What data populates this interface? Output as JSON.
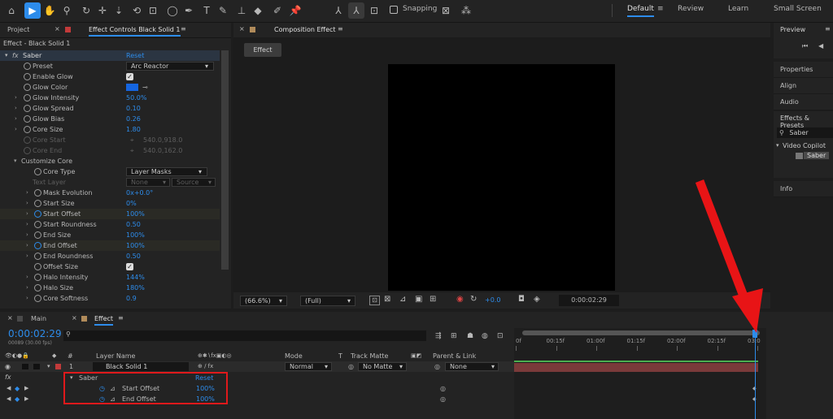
{
  "toolbar": {
    "snapping_label": "Snapping",
    "workspaces": [
      "Default",
      "Review",
      "Learn",
      "Small Screen"
    ]
  },
  "left_panel": {
    "tab_project": "Project",
    "tab_effect_controls": "Effect Controls Black Solid 1",
    "breadcrumb": "Effect - Black Solid 1",
    "effect_name": "Saber",
    "reset": "Reset",
    "props": {
      "preset": {
        "label": "Preset",
        "value": "Arc Reactor"
      },
      "enable_glow": {
        "label": "Enable Glow"
      },
      "glow_color": {
        "label": "Glow Color",
        "color": "#1565e0"
      },
      "glow_intensity": {
        "label": "Glow Intensity",
        "value": "50.0%"
      },
      "glow_spread": {
        "label": "Glow Spread",
        "value": "0.10"
      },
      "glow_bias": {
        "label": "Glow Bias",
        "value": "0.26"
      },
      "core_size": {
        "label": "Core Size",
        "value": "1.80"
      },
      "core_start": {
        "label": "Core Start",
        "value": "540.0,918.0"
      },
      "core_end": {
        "label": "Core End",
        "value": "540.0,162.0"
      },
      "customize_core": {
        "label": "Customize Core"
      },
      "core_type": {
        "label": "Core Type",
        "value": "Layer Masks"
      },
      "text_layer": {
        "label": "Text Layer",
        "value1": "None",
        "value2": "Source"
      },
      "mask_evolution": {
        "label": "Mask Evolution",
        "value": "0x+0.0°"
      },
      "start_size": {
        "label": "Start Size",
        "value": "0%"
      },
      "start_offset": {
        "label": "Start Offset",
        "value": "100%"
      },
      "start_roundness": {
        "label": "Start Roundness",
        "value": "0.50"
      },
      "end_size": {
        "label": "End Size",
        "value": "100%"
      },
      "end_offset": {
        "label": "End Offset",
        "value": "100%"
      },
      "end_roundness": {
        "label": "End Roundness",
        "value": "0.50"
      },
      "offset_size": {
        "label": "Offset Size"
      },
      "halo_intensity": {
        "label": "Halo Intensity",
        "value": "144%"
      },
      "halo_size": {
        "label": "Halo Size",
        "value": "180%"
      },
      "core_softness": {
        "label": "Core Softness",
        "value": "0.9"
      }
    }
  },
  "composition": {
    "tab": "Composition Effect",
    "sub_tab": "Effect",
    "zoom": "(66.6%)",
    "resolution": "(Full)",
    "exposure": "+0.0",
    "timecode": "0:00:02:29"
  },
  "right_panel": {
    "preview": "Preview",
    "properties": "Properties",
    "align": "Align",
    "audio": "Audio",
    "effects_presets": "Effects & Presets",
    "search_value": "Saber",
    "folder": "Video Copilot",
    "effect_item": "Saber",
    "info": "Info"
  },
  "timeline": {
    "tab_main": "Main",
    "tab_effect": "Effect",
    "current_time": "0:00:02:29",
    "frames": "00089 (30.00 fps)",
    "col_num": "#",
    "col_layer_name": "Layer Name",
    "col_mode": "Mode",
    "col_t": "T",
    "col_track_matte": "Track Matte",
    "col_parent": "Parent & Link",
    "layer": {
      "num": "1",
      "name": "Black Solid 1",
      "mode": "Normal",
      "matte": "No Matte",
      "parent": "None"
    },
    "fx_label": "fx",
    "effect_row": {
      "name": "Saber",
      "reset": "Reset"
    },
    "prop_rows": [
      {
        "name": "Start Offset",
        "value": "100%"
      },
      {
        "name": "End Offset",
        "value": "100%"
      }
    ],
    "ruler_labels": [
      "0f",
      "00:15f",
      "01:00f",
      "01:15f",
      "02:00f",
      "02:15f",
      "03:0"
    ],
    "playhead_position_seconds": 2.97
  },
  "colors": {
    "accent": "#2d8ceb",
    "highlight_box": "#e0191b",
    "arrow": "#e81416",
    "layer_bar": "#7a3a3a"
  }
}
